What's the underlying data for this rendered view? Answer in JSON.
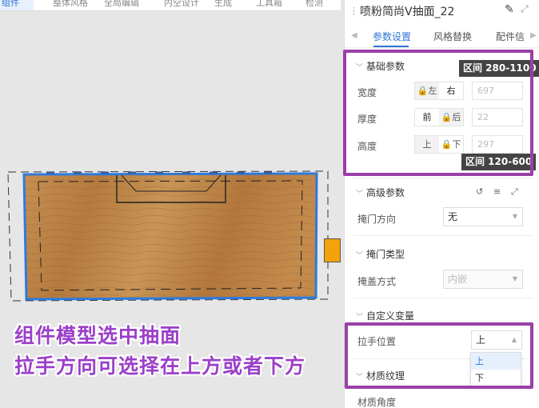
{
  "topbar": {
    "items": [
      "组件",
      "整体风格",
      "全局编辑",
      "内空设计",
      "生成",
      "工具箱",
      "检测"
    ]
  },
  "panel": {
    "title": "喷粉简尚V抽面_22",
    "tabs": [
      "参数设置",
      "风格替换",
      "配件信"
    ],
    "basic": {
      "header": "基础参数",
      "rows": [
        {
          "label": "宽度",
          "opt_a": "左",
          "opt_b": "右",
          "value": "697"
        },
        {
          "label": "厚度",
          "opt_a": "前",
          "opt_b": "后",
          "value": "22"
        },
        {
          "label": "高度",
          "opt_a": "上",
          "opt_b": "下",
          "value": "297"
        }
      ],
      "tip_top": "区间 280-1100",
      "tip_bottom": "区间 120-600"
    },
    "advanced": {
      "header": "高级参数",
      "door_dir_label": "掩门方向",
      "door_dir_value": "无"
    },
    "door_type": {
      "header": "掩门类型",
      "cover_label": "掩盖方式",
      "cover_value": "内嵌"
    },
    "custom": {
      "header": "自定义变量",
      "handle_label": "拉手位置",
      "handle_value": "上",
      "handle_options": [
        "上",
        "下"
      ]
    },
    "material": {
      "header": "材质纹理",
      "angle_label": "材质角度"
    }
  },
  "caption": {
    "line1": "组件模型选中抽面",
    "line2": "拉手方向可选择在上方或者下方"
  },
  "colors": {
    "accent": "#2f74d6",
    "highlight": "#9b3fa8",
    "caption": "#9b3fc9"
  }
}
